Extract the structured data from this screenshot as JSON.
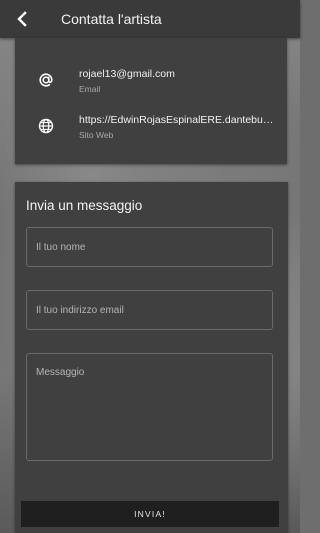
{
  "appbar": {
    "back_icon": "chevron-left-icon",
    "title": "Contatta l'artista"
  },
  "contact_info": {
    "email": {
      "icon": "at-sign-icon",
      "value": "rojael13@gmail.com",
      "label": "Email"
    },
    "website": {
      "icon": "globe-icon",
      "value": "https://EdwinRojasEspinalERE.dantebuonarroti.it",
      "label": "Sito Web"
    }
  },
  "form": {
    "title": "Invia un messaggio",
    "name_placeholder": "Il tuo nome",
    "email_placeholder": "Il tuo indirizzo email",
    "message_placeholder": "Messaggio",
    "send_label": "INVIA!"
  },
  "colors": {
    "appbar_bg": "#3a3a3a",
    "card_bg": "#404040",
    "button_bg": "#1f1f1f"
  }
}
